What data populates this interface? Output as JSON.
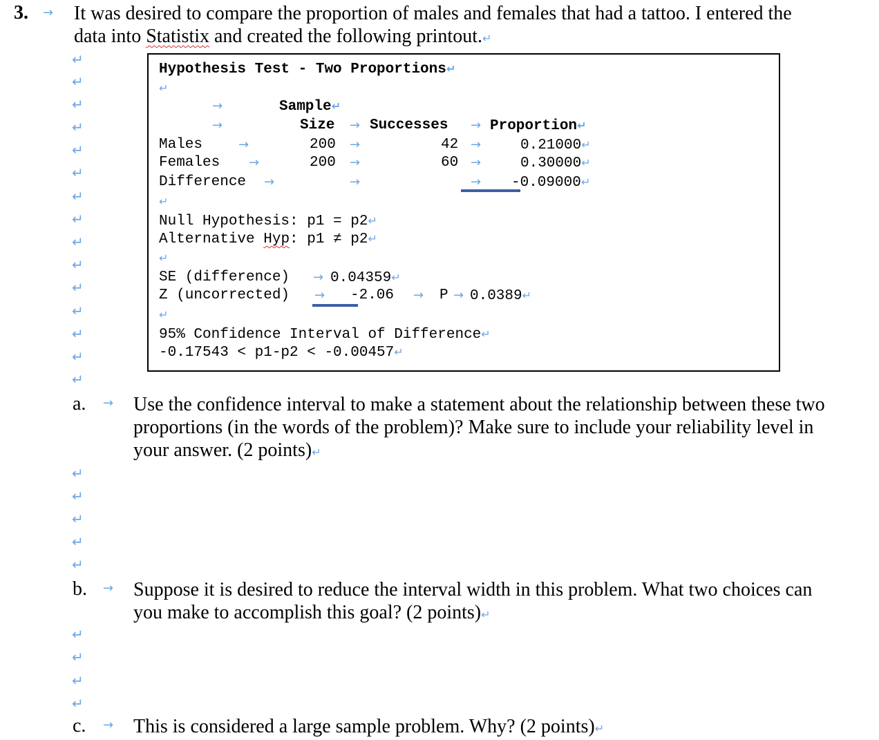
{
  "question": {
    "number": "3.",
    "lines": [
      "It was desired to compare the proportion of males and females that had a tattoo. I entered the",
      "data into ",
      "Statistix",
      " and created the following printout."
    ]
  },
  "printout": {
    "title": "Hypothesis Test - Two Proportions",
    "header_row1": "Sample",
    "header_size": "Size",
    "header_successes": "Successes",
    "header_proportion": "Proportion",
    "rows": [
      {
        "label": "Males",
        "size": "200",
        "successes": "42",
        "proportion": "0.21000"
      },
      {
        "label": "Females",
        "size": "200",
        "successes": "60",
        "proportion": "0.30000"
      },
      {
        "label": "Difference",
        "size": "",
        "successes": "",
        "proportion": "-0.09000"
      }
    ],
    "null_hypothesis": "Null Hypothesis: p1 = p2",
    "alt_hypothesis_prefix": "Alternative ",
    "alt_hypothesis_word": "Hyp",
    "alt_hypothesis_suffix": ": p1 ≠ p2",
    "se_label": "SE (difference)",
    "se_value": "0.04359",
    "z_label": "Z (uncorrected)",
    "z_value": "-2.06",
    "p_label": "P",
    "p_value": "0.0389",
    "ci_title": "95% Confidence Interval of Difference",
    "ci_value": "-0.17543 < p1-p2 < -0.00457"
  },
  "parts": [
    {
      "label": "a.",
      "lines": [
        "Use the confidence interval to make a statement about the relationship between these two",
        "proportions (in the words of the problem)? Make sure to include your reliability level in",
        "your answer. (2 points)"
      ]
    },
    {
      "label": "b.",
      "lines": [
        "Suppose it is desired to reduce the interval width in this problem. What two choices can",
        "you make to accomplish this goal?  (2 points)"
      ]
    },
    {
      "label": "c.",
      "lines": [
        "This is considered a large sample problem. Why?  (2 points)"
      ]
    }
  ],
  "marks": {
    "paragraph": "↵",
    "tab": "→"
  }
}
